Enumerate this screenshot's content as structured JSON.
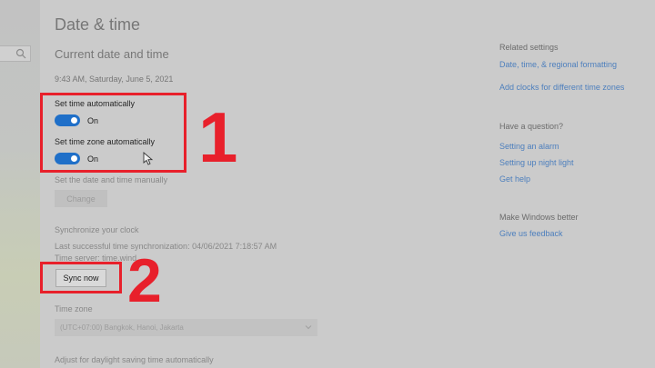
{
  "header": {
    "title": "Date & time"
  },
  "current": {
    "heading": "Current date and time",
    "datetime": "9:43 AM, Saturday, June 5, 2021"
  },
  "settings": {
    "set_time_auto_label": "Set time automatically",
    "set_time_auto_state": "On",
    "set_tz_auto_label": "Set time zone automatically",
    "set_tz_auto_state": "On",
    "manual_label": "Set the date and time manually",
    "change_button": "Change"
  },
  "sync": {
    "heading": "Synchronize your clock",
    "last_sync": "Last successful time synchronization: 04/06/2021 7:18:57 AM",
    "time_server": "Time server: time.wind",
    "sync_button": "Sync now"
  },
  "timezone": {
    "label": "Time zone",
    "value": "(UTC+07:00) Bangkok, Hanoi, Jakarta"
  },
  "dst": {
    "label": "Adjust for daylight saving time automatically"
  },
  "sidebar": {
    "related_heading": "Related settings",
    "related_links": [
      "Date, time, & regional formatting",
      "Add clocks for different time zones"
    ],
    "question_heading": "Have a question?",
    "question_links": [
      "Setting an alarm",
      "Setting up night light",
      "Get help"
    ],
    "better_heading": "Make Windows better",
    "better_links": [
      "Give us feedback"
    ]
  },
  "annotations": {
    "num1": "1",
    "num2": "2"
  },
  "colors": {
    "accent": "#1f6fc8",
    "annotation_red": "#e8202b",
    "link": "#4d7fbd"
  },
  "icons": {
    "search": "search-icon",
    "cursor": "mouse-cursor-icon",
    "chevron": "chevron-down-icon"
  }
}
